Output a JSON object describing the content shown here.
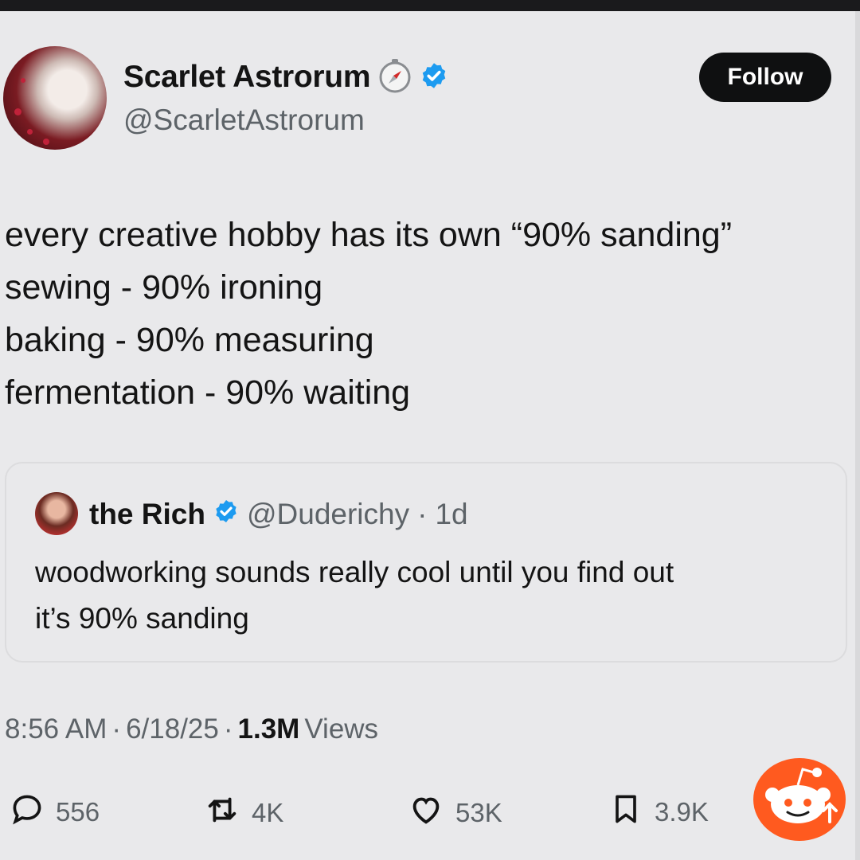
{
  "author": {
    "name": "Scarlet Astrorum",
    "handle": "@ScarletAstrorum"
  },
  "follow_label": "Follow",
  "tweet_lines": [
    "every creative hobby has its own “90% sanding”",
    "sewing - 90% ironing",
    "baking - 90% measuring",
    "fermentation - 90% waiting"
  ],
  "quoted": {
    "name": "the Rich",
    "handle": "@Duderichy",
    "time": "1d",
    "text_lines": [
      "woodworking sounds really cool until you find out",
      "it’s 90% sanding"
    ]
  },
  "meta": {
    "time": "8:56 AM",
    "date": "6/18/25",
    "views_count": "1.3M",
    "views_label": "Views"
  },
  "actions": {
    "replies": "556",
    "reposts": "4K",
    "likes": "53K",
    "bookmarks": "3.9K"
  },
  "colors": {
    "verified": "#1d9bf0",
    "reddit": "#ff5a1f",
    "text": "#141414",
    "muted": "#5d6368"
  }
}
